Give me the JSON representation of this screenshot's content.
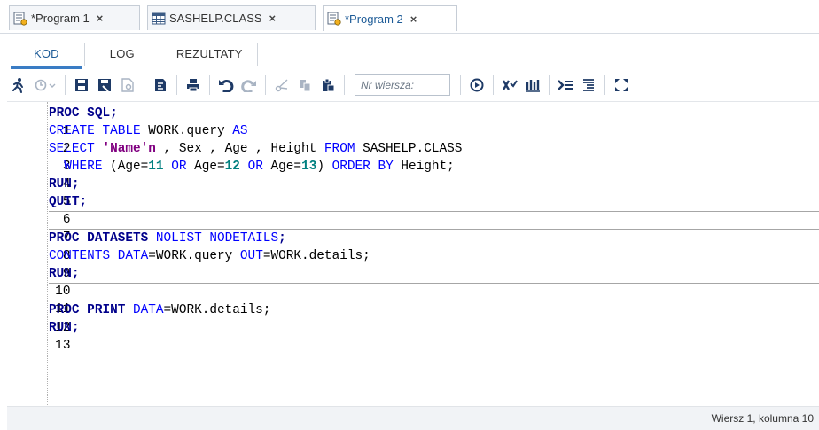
{
  "tabs": [
    {
      "label": "*Program 1",
      "icon": "program-icon"
    },
    {
      "label": "SASHELP.CLASS",
      "icon": "table-icon"
    },
    {
      "label": "*Program 2",
      "icon": "program-icon"
    }
  ],
  "close_glyph": "×",
  "subtabs": [
    "KOD",
    "LOG",
    "REZULTATY"
  ],
  "toolbar": {
    "line_placeholder": "Nr wiersza:"
  },
  "code_lines": [
    {
      "n": "1"
    },
    {
      "n": "2"
    },
    {
      "n": "3"
    },
    {
      "n": "4"
    },
    {
      "n": "5"
    },
    {
      "n": "6"
    },
    {
      "n": "7"
    },
    {
      "n": "8"
    },
    {
      "n": "9"
    },
    {
      "n": "10"
    },
    {
      "n": "11"
    },
    {
      "n": "12"
    },
    {
      "n": "13"
    }
  ],
  "code": {
    "l1_a": "PROC SQL",
    "l1_b": ";",
    "l2_a": "CREATE TABLE",
    "l2_b": " WORK.query ",
    "l2_c": "AS",
    "l3_a": "SELECT",
    "l3_b": " ",
    "l3_c": "'Name'n",
    "l3_d": " , Sex , Age , Height ",
    "l3_e": "FROM",
    "l3_f": " SASHELP.CLASS",
    "l4_a": "  WHERE",
    "l4_b": " (Age=",
    "l4_c": "11",
    "l4_d": " ",
    "l4_e": "OR",
    "l4_f": " Age=",
    "l4_g": "12",
    "l4_h": " ",
    "l4_i": "OR",
    "l4_j": " Age=",
    "l4_k": "13",
    "l4_l": ") ",
    "l4_m": "ORDER BY",
    "l4_n": " Height;",
    "l5_a": "RUN",
    "l5_b": ";",
    "l6_a": "QUIT",
    "l6_b": ";",
    "l8_a": "PROC DATASETS",
    "l8_b": " ",
    "l8_c": "NOLIST NODETAILS",
    "l8_d": ";",
    "l9_a": "CONTENTS",
    "l9_b": " ",
    "l9_c": "DATA",
    "l9_d": "=WORK.query ",
    "l9_e": "OUT",
    "l9_f": "=WORK.details;",
    "l10_a": "RUN",
    "l10_b": ";",
    "l12_a": "PROC PRINT",
    "l12_b": " ",
    "l12_c": "DATA",
    "l12_d": "=WORK.details;",
    "l13_a": "RUN",
    "l13_b": ";"
  },
  "status": "Wiersz 1, kolumna 10"
}
